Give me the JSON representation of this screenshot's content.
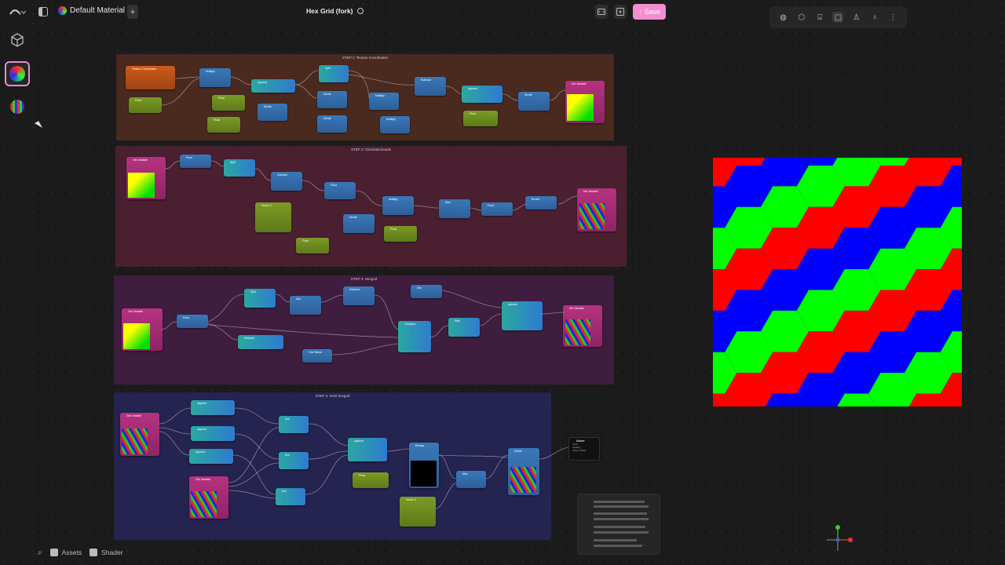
{
  "topbar": {
    "material_name": "Default Material",
    "title": "Hex Grid (fork)",
    "save_label": "Save"
  },
  "groups": [
    {
      "title": "STEP 1: Texture Coordinates"
    },
    {
      "title": "STEP 2: Orientationmask"
    },
    {
      "title": "STEP 3: Hexgrid"
    },
    {
      "title": "STEP 4: RGB hexgrid"
    }
  ],
  "nodes": {
    "tex_coord": "Texture Coordinates",
    "multiply": "Multiply",
    "divide": "Divide",
    "split": "Split",
    "subtract": "Subtract",
    "append": "Append",
    "set_variable": "Set Variable",
    "get_variable": "Get Variable",
    "floor": "Floor",
    "vector2": "Vector 2",
    "float": "Float",
    "sine": "Sine",
    "fract": "Fract",
    "round": "Round",
    "abs": "Abs",
    "add": "Add",
    "max": "Max",
    "step": "Step",
    "compare": "Compare",
    "one_minus": "One Minus",
    "dot": "Dot",
    "lerp": "Lerp",
    "remap": "Remap",
    "master": "Master",
    "master_inputs": [
      "Color",
      "Opacity",
      "Vertex Offset"
    ],
    "float_values": [
      "1",
      "2",
      "1.732",
      "0.5"
    ]
  },
  "viewport": {
    "tools": [
      "sphere-icon",
      "cube-icon",
      "cylinder-icon",
      "plane-icon",
      "figure-icon",
      "light-icon",
      "more-icon"
    ],
    "active_tool": "plane-icon"
  },
  "bottom": {
    "assets_label": "Assets",
    "shader_label": "Shader"
  },
  "colors": {
    "accent": "#f18fcf",
    "hex_red": "#ff0000",
    "hex_green": "#00ff00",
    "hex_blue": "#0000ff",
    "group1": "#4a2a1f",
    "group2": "#4a2030",
    "group3": "#3e1d3e",
    "group4": "#25234f"
  }
}
